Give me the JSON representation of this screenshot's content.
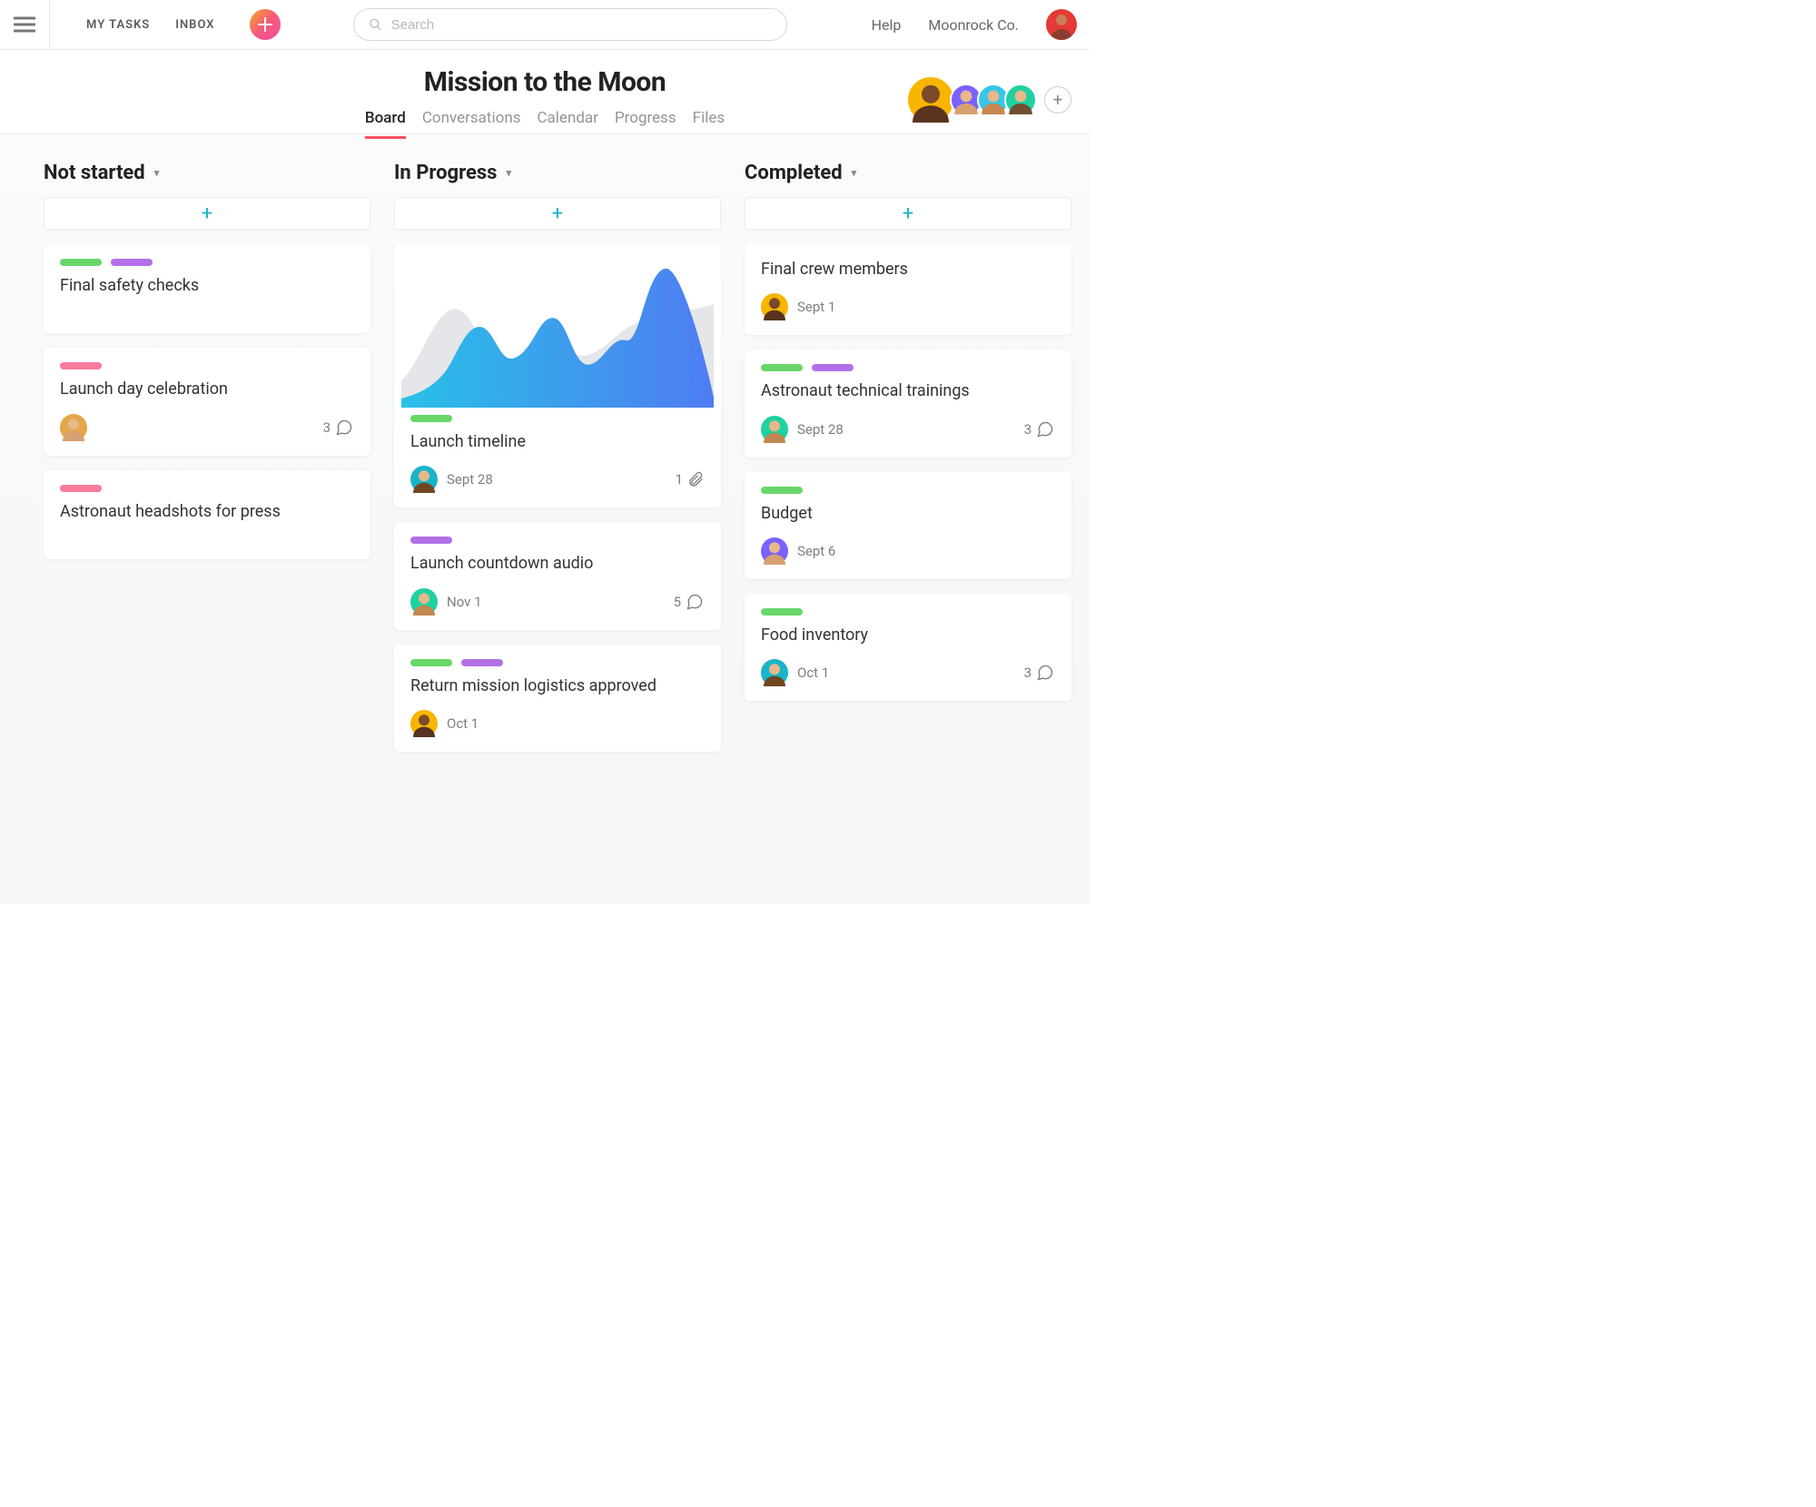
{
  "topnav": {
    "my_tasks": "MY TASKS",
    "inbox": "INBOX",
    "search_placeholder": "Search",
    "help": "Help",
    "org": "Moonrock Co."
  },
  "project": {
    "title": "Mission to the Moon",
    "tabs": {
      "board": "Board",
      "conversations": "Conversations",
      "calendar": "Calendar",
      "progress": "Progress",
      "files": "Files"
    },
    "member_colors": [
      "#f7b500",
      "#7b61ff",
      "#35c6e8",
      "#1fd1a1"
    ],
    "user_avatar_bg": "#e53935"
  },
  "columns": [
    {
      "title": "Not started",
      "cards": [
        {
          "tags": [
            "green",
            "purple"
          ],
          "title": "Final safety checks"
        },
        {
          "tags": [
            "pink"
          ],
          "title": "Launch day celebration",
          "avatar_bg": "#e4a64a",
          "comments": 3
        },
        {
          "tags": [
            "pink"
          ],
          "title": "Astronaut headshots for press"
        }
      ]
    },
    {
      "title": "In Progress",
      "cards": [
        {
          "chart": true,
          "tags": [
            "green"
          ],
          "title": "Launch timeline",
          "avatar_bg": "#18b4c9",
          "date": "Sept 28",
          "attachments": 1
        },
        {
          "tags": [
            "purple"
          ],
          "title": "Launch countdown audio",
          "avatar_bg": "#1fd1a1",
          "date": "Nov 1",
          "comments": 5
        },
        {
          "tags": [
            "green",
            "purple"
          ],
          "title": "Return mission logistics approved",
          "avatar_bg": "#f7b500",
          "date": "Oct 1"
        }
      ]
    },
    {
      "title": "Completed",
      "cards": [
        {
          "title": "Final crew members",
          "avatar_bg": "#f7b500",
          "date": "Sept 1"
        },
        {
          "tags": [
            "green",
            "purple"
          ],
          "title": "Astronaut technical trainings",
          "avatar_bg": "#1fd1a1",
          "date": "Sept 28",
          "comments": 3
        },
        {
          "tags": [
            "green"
          ],
          "title": "Budget",
          "avatar_bg": "#7b61ff",
          "date": "Sept 6"
        },
        {
          "tags": [
            "green"
          ],
          "title": "Food inventory",
          "avatar_bg": "#18b4c9",
          "date": "Oct 1",
          "comments": 3
        }
      ]
    }
  ],
  "chart_data": {
    "type": "area",
    "note": "decorative sparkline inside a task card; values are visual estimates (no axes)",
    "x": [
      0,
      1,
      2,
      3,
      4,
      5,
      6,
      7,
      8,
      9,
      10,
      11
    ],
    "series": [
      {
        "name": "back-gray",
        "values": [
          30,
          45,
          80,
          60,
          40,
          35,
          55,
          45,
          40,
          55,
          65,
          70
        ],
        "color": "#e4e6ea"
      },
      {
        "name": "front-blue",
        "values": [
          12,
          18,
          22,
          38,
          55,
          40,
          60,
          42,
          35,
          52,
          48,
          95
        ],
        "color_gradient": [
          "#29c0e7",
          "#4f7cf2"
        ]
      }
    ],
    "ylim": [
      0,
      100
    ]
  }
}
